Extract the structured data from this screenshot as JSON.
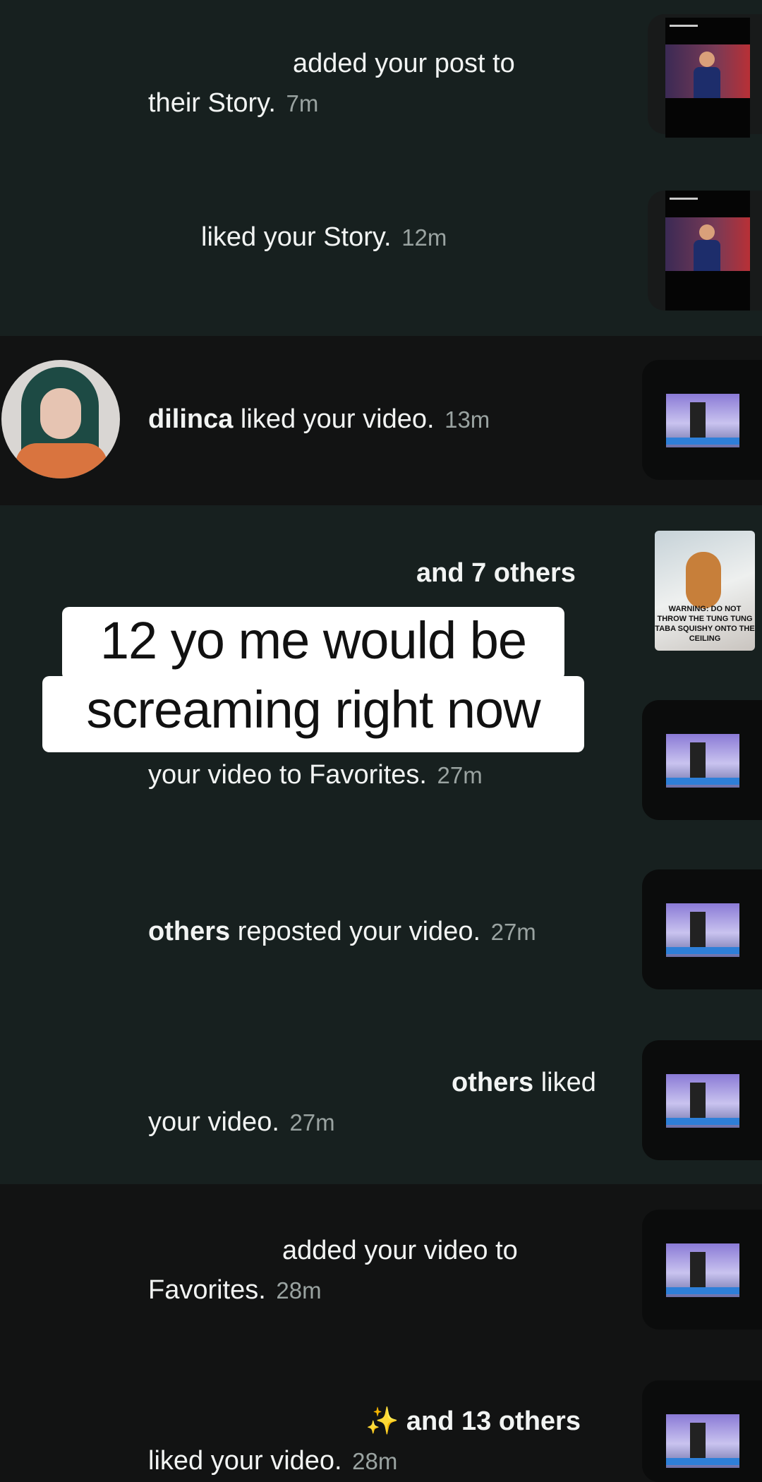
{
  "notifications": [
    {
      "text": "added your post to",
      "text2": "their Story.",
      "time": "7m"
    },
    {
      "text": "liked your Story.",
      "time": "12m"
    },
    {
      "user": "dilinca",
      "text": " liked your video.",
      "time": "13m"
    },
    {
      "text": "and 7 others"
    },
    {
      "text": "your video to Favorites.",
      "time": "27m"
    },
    {
      "user": "others",
      "text": " reposted your video.",
      "time": "27m"
    },
    {
      "user": "others",
      "text_prefix": "",
      "text": " liked",
      "text2": "your video.",
      "time": "27m"
    },
    {
      "text": "added your video to",
      "text2": "Favorites.",
      "time": "28m"
    },
    {
      "emoji": "✨",
      "user": "and 13 others",
      "text2": "liked your video.",
      "time": "28m"
    }
  ],
  "thumbnail_badges": {
    "comment_warning": "WARNING: DO NOT THROW THE TUNG TUNG TABA SQUISHY ONTO THE CEILING"
  },
  "caption": {
    "line1": "12 yo me would be",
    "line2": "screaming right now"
  },
  "colors": {
    "bg_unread": "#17201f",
    "bg_read": "#121313",
    "time_gray": "#9aa3a1",
    "caption_bg": "#ffffff"
  }
}
